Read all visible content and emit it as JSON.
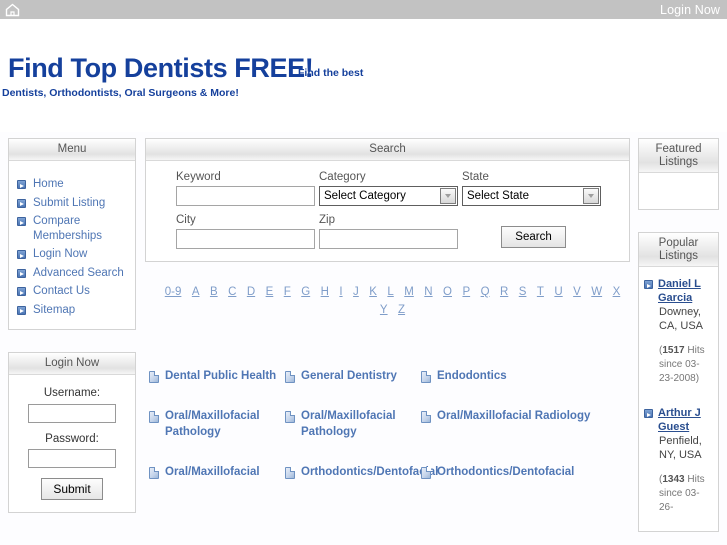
{
  "topbar": {
    "home_icon": "home-icon",
    "login_link": "Login Now"
  },
  "masthead": {
    "title": "Find Top Dentists FREE!",
    "tagline_primary": "Find the best",
    "tagline_secondary": "Dentists, Orthodontists, Oral Surgeons & More!"
  },
  "colors": {
    "brand_blue": "#15409c",
    "link_blue": "#4f76b4",
    "topbar_gray": "#c2c2c2",
    "panel_border": "#d3d3d3"
  },
  "sidebar": {
    "menu": {
      "header": "Menu",
      "items": [
        {
          "label": "Home"
        },
        {
          "label": "Submit Listing"
        },
        {
          "label": "Compare Memberships"
        },
        {
          "label": "Login Now"
        },
        {
          "label": "Advanced Search"
        },
        {
          "label": "Contact Us"
        },
        {
          "label": "Sitemap"
        }
      ]
    },
    "login": {
      "header": "Login Now",
      "username_label": "Username:",
      "username_value": "",
      "password_label": "Password:",
      "password_value": "",
      "submit_label": "Submit"
    }
  },
  "search": {
    "header": "Search",
    "keyword_label": "Keyword",
    "keyword_value": "",
    "category_label": "Category",
    "category_value": "Select Category",
    "state_label": "State",
    "state_value": "Select State",
    "city_label": "City",
    "city_value": "",
    "zip_label": "Zip",
    "zip_value": "",
    "button_label": "Search"
  },
  "alpha_nav": {
    "items": [
      "0-9",
      "A",
      "B",
      "C",
      "D",
      "E",
      "F",
      "G",
      "H",
      "I",
      "J",
      "K",
      "L",
      "M",
      "N",
      "O",
      "P",
      "Q",
      "R",
      "S",
      "T",
      "U",
      "V",
      "W",
      "X",
      "Y",
      "Z"
    ]
  },
  "categories": {
    "items": [
      {
        "label": "Dental Public Health"
      },
      {
        "label": "General Dentistry"
      },
      {
        "label": "Endodontics"
      },
      {
        "label": "Oral/Maxillofacial Pathology"
      },
      {
        "label": "Oral/Maxillofacial Pathology"
      },
      {
        "label": "Oral/Maxillofacial Radiology"
      },
      {
        "label": "Oral/Maxillofacial"
      },
      {
        "label": "Orthodontics/Dentofacial"
      },
      {
        "label": "Orthodontics/Dentofacial"
      }
    ]
  },
  "featured": {
    "header_line1": "Featured",
    "header_line2": "Listings",
    "items": []
  },
  "popular": {
    "header_line1": "Popular",
    "header_line2": "Listings",
    "items": [
      {
        "name": "Daniel L Garcia",
        "location": "Downey, CA, USA",
        "hits_open": "(",
        "hits_count": "1517",
        "hits_text": " Hits since 03-23-2008)"
      },
      {
        "name": "Arthur J Guest",
        "location": "Penfield, NY, USA",
        "hits_open": "(",
        "hits_count": "1343",
        "hits_text": " Hits since 03-26-"
      }
    ]
  }
}
